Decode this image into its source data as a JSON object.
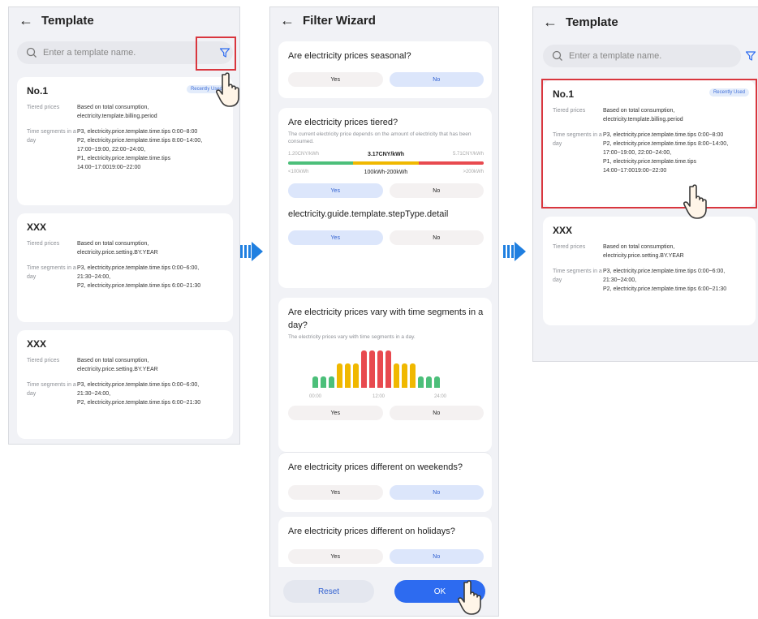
{
  "left": {
    "title": "Template",
    "search_placeholder": "Enter a template name.",
    "cards": [
      {
        "name": "No.1",
        "badge": "Recently Used",
        "tier_label": "Tiered prices",
        "tier_value": "Based on total consumption, electricity.template.billing.period",
        "time_label": "Time segments in a day",
        "time_lines": [
          "P3,   electricity.price.template.time.tips  0:00~8:00",
          "P2,   electricity.price.template.time.tips  8:00~14:00, 17:00~19:00, 22:00~24:00,",
          "P1,   electricity.price.template.time.tips  14:00~17:0019:00~22:00"
        ]
      },
      {
        "name": "XXX",
        "tier_label": "Tiered prices",
        "tier_value": "Based on total consumption, electricity.price.setting.BY.YEAR",
        "time_label": "Time segments in a day",
        "time_lines": [
          "P3,   electricity.price.template.time.tips  0:00~6:00, 21:30~24:00,",
          "P2,   electricity.price.template.time.tips  6:00~21:30"
        ]
      },
      {
        "name": "XXX",
        "tier_label": "Tiered prices",
        "tier_value": "Based on total consumption, electricity.price.setting.BY.YEAR",
        "time_label": "Time segments in a day",
        "time_lines": [
          "P3,   electricity.price.template.time.tips  0:00~6:00, 21:30~24:00,",
          "P2,   electricity.price.template.time.tips  6:00~21:30"
        ]
      }
    ]
  },
  "mid": {
    "title": "Filter Wizard",
    "yes": "Yes",
    "no": "No",
    "q1": "Are electricity prices seasonal?",
    "q2": "Are electricity prices tiered?",
    "q2_desc": "The current electricity price depends on the amount of electricity that has been consumed.",
    "tier_prices": [
      "1.20CNY/kWh",
      "3.17CNY/kWh",
      "5.71CNY/kWh"
    ],
    "tier_ranges": [
      "<100kWh",
      "100kWh-200kWh",
      ">200kWh"
    ],
    "step_detail": "electricity.guide.template.stepType.detail",
    "q3": "Are electricity prices vary with time segments in a day?",
    "q3_desc": "The electricity prices vary with time segments in a day.",
    "time_axis": [
      "00:00",
      "12:00",
      "24:00"
    ],
    "time_bar_levels": [
      1,
      1,
      1,
      2,
      2,
      2,
      3,
      3,
      3,
      3,
      2,
      2,
      2,
      1,
      1,
      1
    ],
    "q4": "Are electricity prices different on weekends?",
    "q5": "Are electricity prices different on holidays?",
    "reset": "Reset",
    "ok": "OK"
  },
  "right": {
    "title": "Template",
    "search_placeholder": "Enter a template name.",
    "cards": [
      {
        "name": "No.1",
        "badge": "Recently Used",
        "tier_label": "Tiered prices",
        "tier_value": "Based on total consumption, electricity.template.billing.period",
        "time_label": "Time segments in a day",
        "time_lines": [
          "P3,   electricity.price.template.time.tips  0:00~8:00",
          "P2,   electricity.price.template.time.tips  8:00~14:00, 17:00~19:00, 22:00~24:00,",
          "P1,   electricity.price.template.time.tips  14:00~17:0019:00~22:00"
        ]
      },
      {
        "name": "XXX",
        "tier_label": "Tiered prices",
        "tier_value": "Based on total consumption, electricity.price.setting.BY.YEAR",
        "time_label": "Time segments in a day",
        "time_lines": [
          "P3,   electricity.price.template.time.tips  0:00~6:00, 21:30~24:00,",
          "P2,   electricity.price.template.time.tips  6:00~21:30"
        ]
      }
    ]
  },
  "colors": {
    "accent": "#2d6bf0",
    "highlight": "#d9363e",
    "low": "#4cbf7a",
    "mid": "#f0b800",
    "high": "#e84a4f",
    "arrow": "#1f7fe0"
  }
}
